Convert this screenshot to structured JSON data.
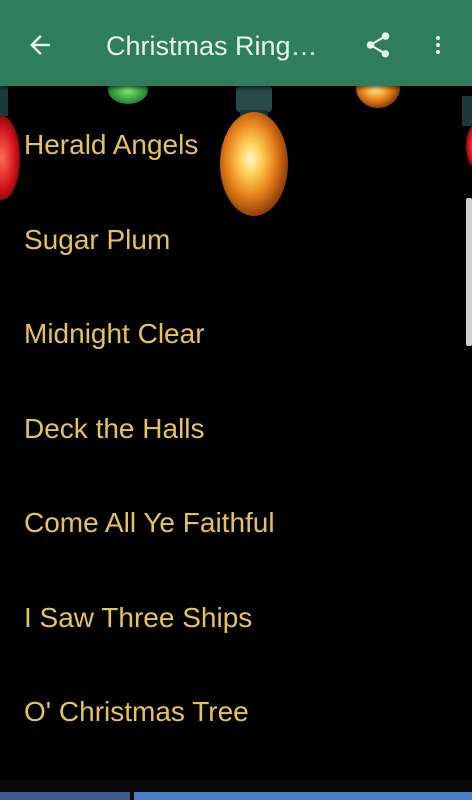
{
  "app_bar": {
    "title": "Christmas Ring…",
    "back_icon": "arrow-left-icon",
    "share_icon": "share-icon",
    "more_icon": "more-vert-icon",
    "background": "#2e7d5b"
  },
  "songs": [
    "Herald Angels",
    "Sugar Plum",
    "Midnight Clear",
    "Deck the Halls",
    "Come All Ye Faithful",
    "I Saw Three Ships",
    "O' Christmas Tree"
  ],
  "colors": {
    "item_text": "#e6c35a",
    "background": "#000000"
  }
}
